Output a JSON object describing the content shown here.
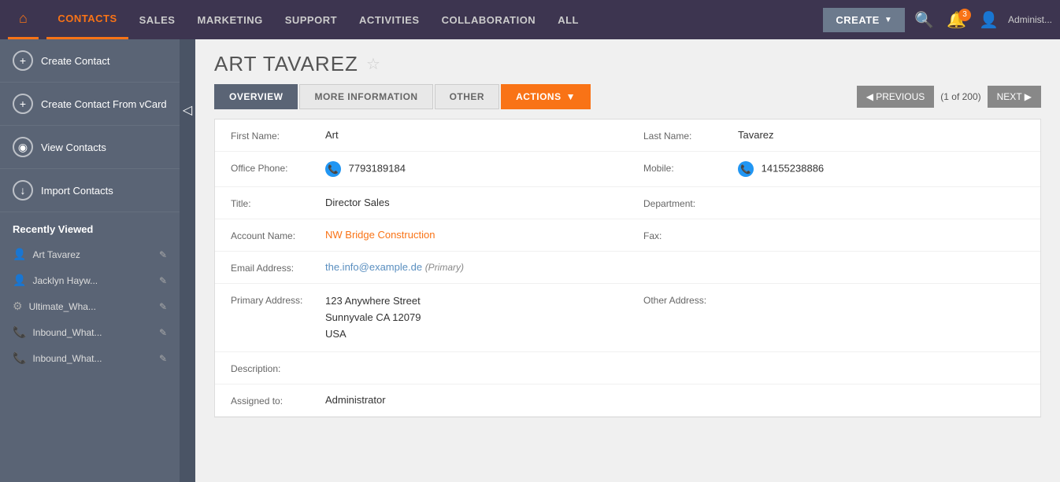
{
  "nav": {
    "home_icon": "⌂",
    "items": [
      {
        "label": "CONTACTS",
        "active": true
      },
      {
        "label": "SALES",
        "active": false
      },
      {
        "label": "MARKETING",
        "active": false
      },
      {
        "label": "SUPPORT",
        "active": false
      },
      {
        "label": "ACTIVITIES",
        "active": false
      },
      {
        "label": "COLLABORATION",
        "active": false
      },
      {
        "label": "ALL",
        "active": false
      }
    ],
    "create_label": "CREATE",
    "notif_count": "3",
    "admin_label": "Administ..."
  },
  "sidebar": {
    "menu_items": [
      {
        "icon": "+",
        "label": "Create Contact"
      },
      {
        "icon": "+",
        "label": "Create Contact From vCard"
      },
      {
        "icon": "◉",
        "label": "View Contacts"
      },
      {
        "icon": "↓",
        "label": "Import Contacts"
      }
    ],
    "recently_viewed_label": "Recently Viewed",
    "recent_items": [
      {
        "name": "Art Tavarez",
        "type": "person"
      },
      {
        "name": "Jacklyn Hayw...",
        "type": "person"
      },
      {
        "name": "Ultimate_Wha...",
        "type": "gear"
      },
      {
        "name": "Inbound_What...",
        "type": "phone"
      },
      {
        "name": "Inbound_What...",
        "type": "phone"
      }
    ]
  },
  "contact": {
    "name": "ART TAVAREZ",
    "star": "☆",
    "tabs": [
      {
        "label": "OVERVIEW",
        "active": true
      },
      {
        "label": "MORE INFORMATION",
        "active": false
      },
      {
        "label": "OTHER",
        "active": false
      },
      {
        "label": "ACTIONS",
        "active": false,
        "is_actions": true
      }
    ],
    "pagination": {
      "prev_label": "◀ PREVIOUS",
      "info": "(1 of 200)",
      "next_label": "NEXT ▶"
    },
    "fields": {
      "first_name_label": "First Name:",
      "first_name": "Art",
      "last_name_label": "Last Name:",
      "last_name": "Tavarez",
      "office_phone_label": "Office Phone:",
      "office_phone": "7793189184",
      "mobile_label": "Mobile:",
      "mobile": "14155238886",
      "title_label": "Title:",
      "title": "Director Sales",
      "department_label": "Department:",
      "department": "",
      "account_name_label": "Account Name:",
      "account_name": "NW Bridge Construction",
      "fax_label": "Fax:",
      "fax": "",
      "email_label": "Email Address:",
      "email": "the.info@example.de",
      "email_tag": "(Primary)",
      "primary_address_label": "Primary Address:",
      "primary_address_line1": "123 Anywhere Street",
      "primary_address_line2": "Sunnyvale CA  12079",
      "primary_address_line3": "USA",
      "other_address_label": "Other Address:",
      "other_address": "",
      "description_label": "Description:",
      "description": "",
      "assigned_to_label": "Assigned to:",
      "assigned_to": "Administrator"
    }
  }
}
